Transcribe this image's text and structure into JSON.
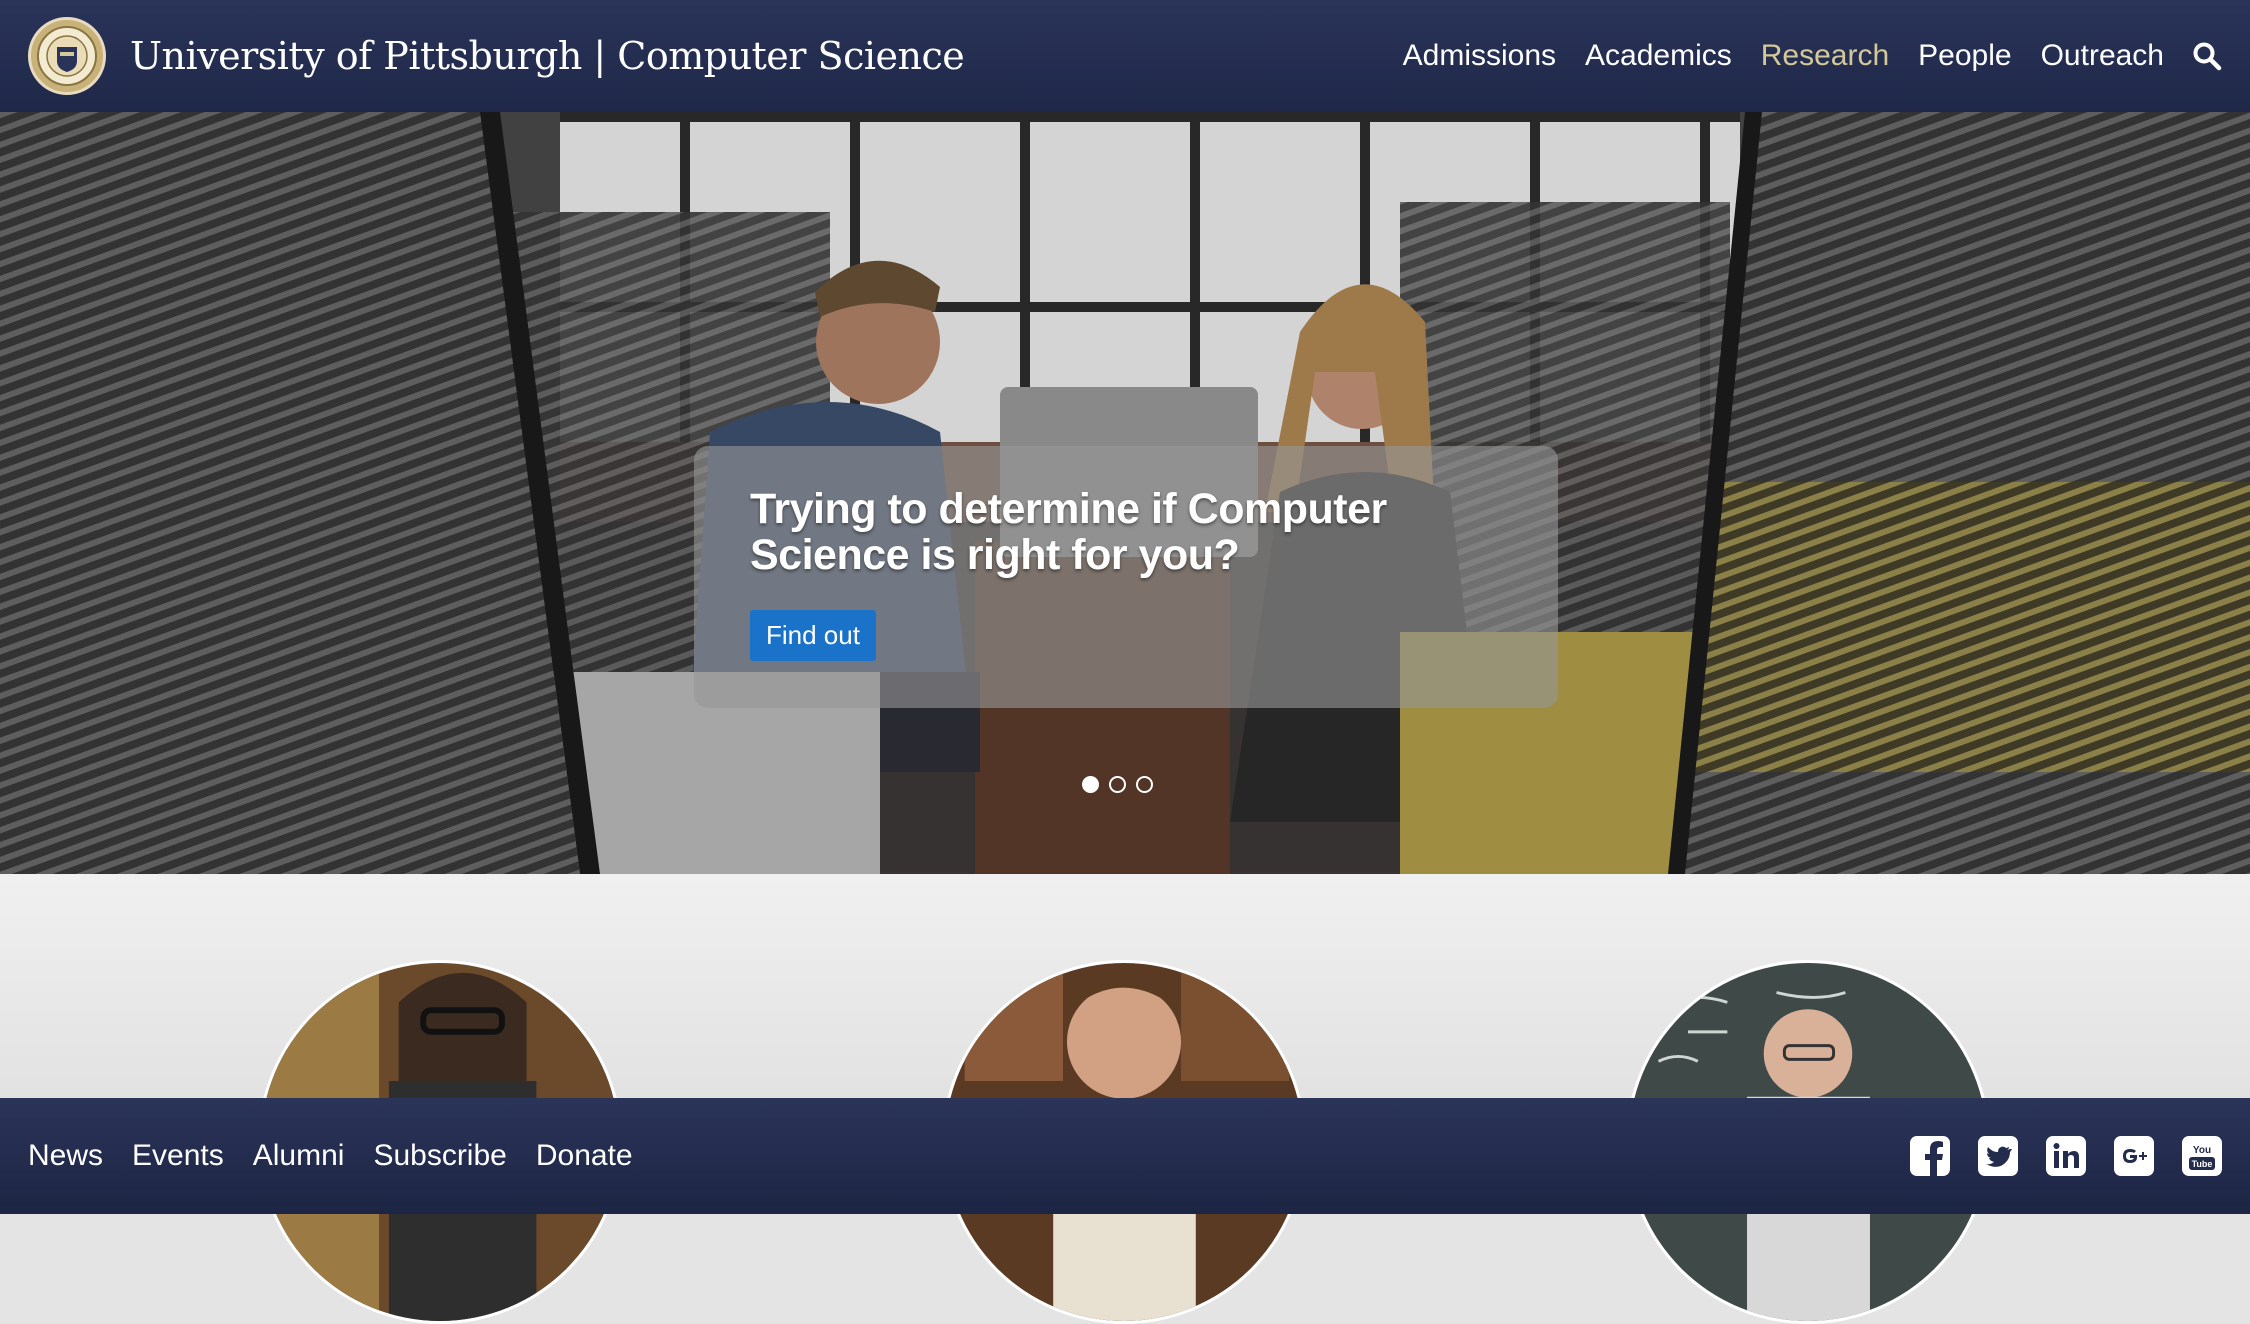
{
  "header": {
    "brand": "University of Pittsburgh | Computer Science",
    "nav": [
      {
        "label": "Admissions",
        "active": false
      },
      {
        "label": "Academics",
        "active": false
      },
      {
        "label": "Research",
        "active": true
      },
      {
        "label": "People",
        "active": false
      },
      {
        "label": "Outreach",
        "active": false
      }
    ],
    "search_icon": "search-icon"
  },
  "hero": {
    "caption_title": "Trying to determine if Computer Science is right for you?",
    "cta_label": "Find out",
    "slides": 3,
    "active_slide": 1
  },
  "profiles": [
    "student-photo",
    "student-photo",
    "professor-photo"
  ],
  "footer": {
    "links": [
      "News",
      "Events",
      "Alumni",
      "Subscribe",
      "Donate"
    ],
    "social": [
      "facebook-icon",
      "twitter-icon",
      "linkedin-icon",
      "google-plus-icon",
      "youtube-icon"
    ]
  },
  "colors": {
    "header_bg": "#252e51",
    "nav_active": "#d3c89a",
    "cta": "#1a73c8",
    "footer_bg": "#242d4f"
  }
}
